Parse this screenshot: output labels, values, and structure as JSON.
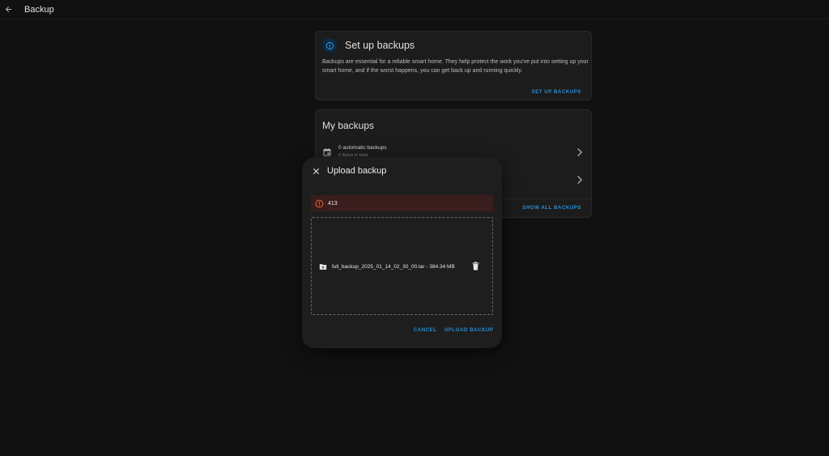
{
  "topbar": {
    "title": "Backup"
  },
  "setup_card": {
    "title": "Set up backups",
    "description": "Backups are essential for a reliable smart home. They help protect the work you've put into setting up your smart home, and if the worst happens, you can get back up and running quickly.",
    "button": "SET UP BACKUPS"
  },
  "my_backups": {
    "title": "My backups",
    "rows": [
      {
        "primary": "0 automatic backups",
        "secondary": "0 Bytes in total"
      },
      {
        "primary": "",
        "secondary": ""
      }
    ],
    "show_all": "SHOW ALL BACKUPS"
  },
  "dialog": {
    "title": "Upload backup",
    "error_code": "413",
    "file": "full_backup_2025_01_14_02_30_00.tar - 384.34 MB",
    "cancel": "CANCEL",
    "upload": "UPLOAD BACKUP"
  },
  "colors": {
    "background": "#111111",
    "card": "#1c1c1c",
    "accent": "#2f8fd6",
    "error_bg": "#3a1d1d",
    "error_icon": "#e0533d"
  },
  "icons": {
    "back": "arrow-left-icon",
    "info": "info-icon",
    "calendar": "calendar-icon",
    "chevron": "chevron-right-icon",
    "close": "close-icon",
    "alert": "alert-circle-icon",
    "file": "folder-upload-icon",
    "trash": "trash-icon"
  }
}
